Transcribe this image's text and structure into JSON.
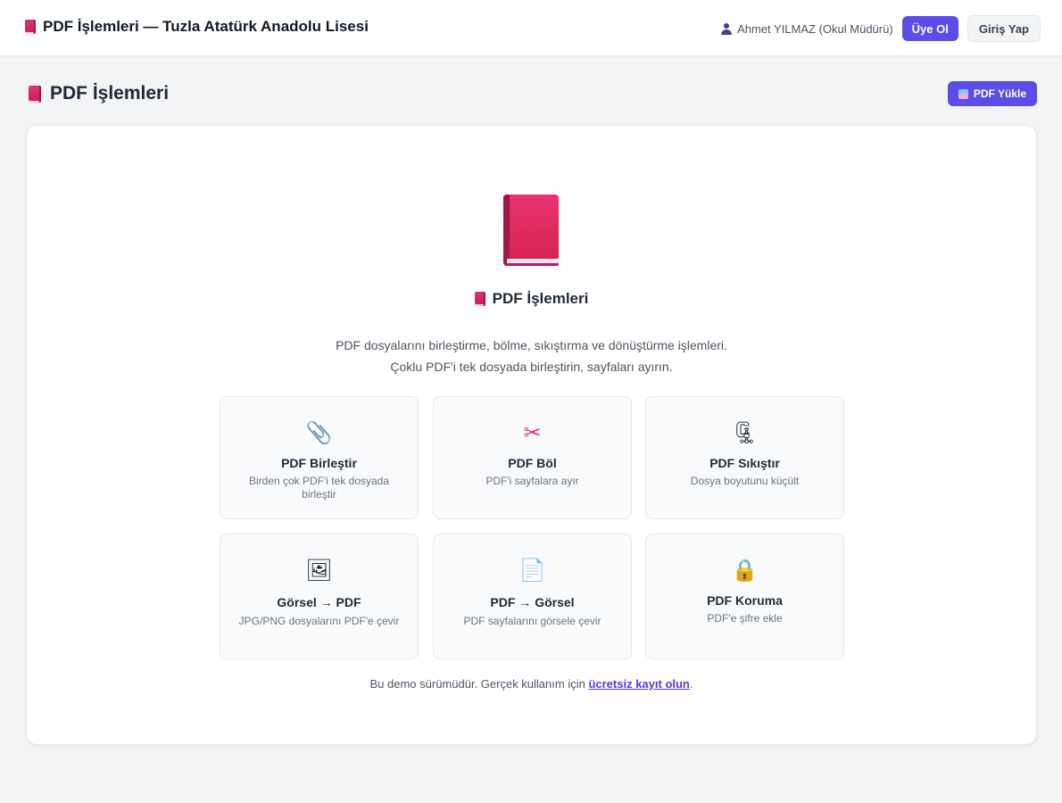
{
  "header": {
    "title": "PDF İşlemleri — Tuzla Atatürk Anadolu Lisesi",
    "user_name": "Ahmet YILMAZ (Okul Müdürü)",
    "signup_label": "Üye Ol",
    "login_label": "Giriş Yap"
  },
  "page": {
    "title": "PDF İşlemleri",
    "upload_label": "PDF Yükle"
  },
  "card": {
    "title": "PDF İşlemleri",
    "description_line1": "PDF dosyalarını birleştirme, bölme, sıkıştırma ve dönüştürme işlemleri.",
    "description_line2": "Çoklu PDF'i tek dosyada birleştirin, sayfaları ayırın.",
    "tools": [
      {
        "icon": "paperclip-icon",
        "glyph": "📎",
        "title": "PDF Birleştir",
        "desc": "Birden çok PDF'i tek dosyada birleştir"
      },
      {
        "icon": "scissors-icon",
        "glyph": "✂",
        "title": "PDF Böl",
        "desc": "PDF'i sayfalara ayır"
      },
      {
        "icon": "clamp-icon",
        "glyph": "🗜",
        "title": "PDF Sıkıştır",
        "desc": "Dosya boyutunu küçült"
      },
      {
        "icon": "framed-picture-icon",
        "glyph": "🖼",
        "title": "Görsel → PDF",
        "desc": "JPG/PNG dosyalarını PDF'e çevir"
      },
      {
        "icon": "document-icon",
        "glyph": "📄",
        "title": "PDF → Görsel",
        "desc": "PDF sayfalarını görsele çevir"
      },
      {
        "icon": "lock-icon",
        "glyph": "🔒",
        "title": "PDF Koruma",
        "desc": "PDF'e şifre ekle"
      }
    ],
    "footer_text": "Bu demo sürümüdür. Gerçek kullanım için",
    "footer_link": "ücretsiz kayıt olun",
    "footer_end": "."
  },
  "colors": {
    "accent": "#5b4ee8",
    "book": "#d62452",
    "background": "#f3f4f6"
  }
}
